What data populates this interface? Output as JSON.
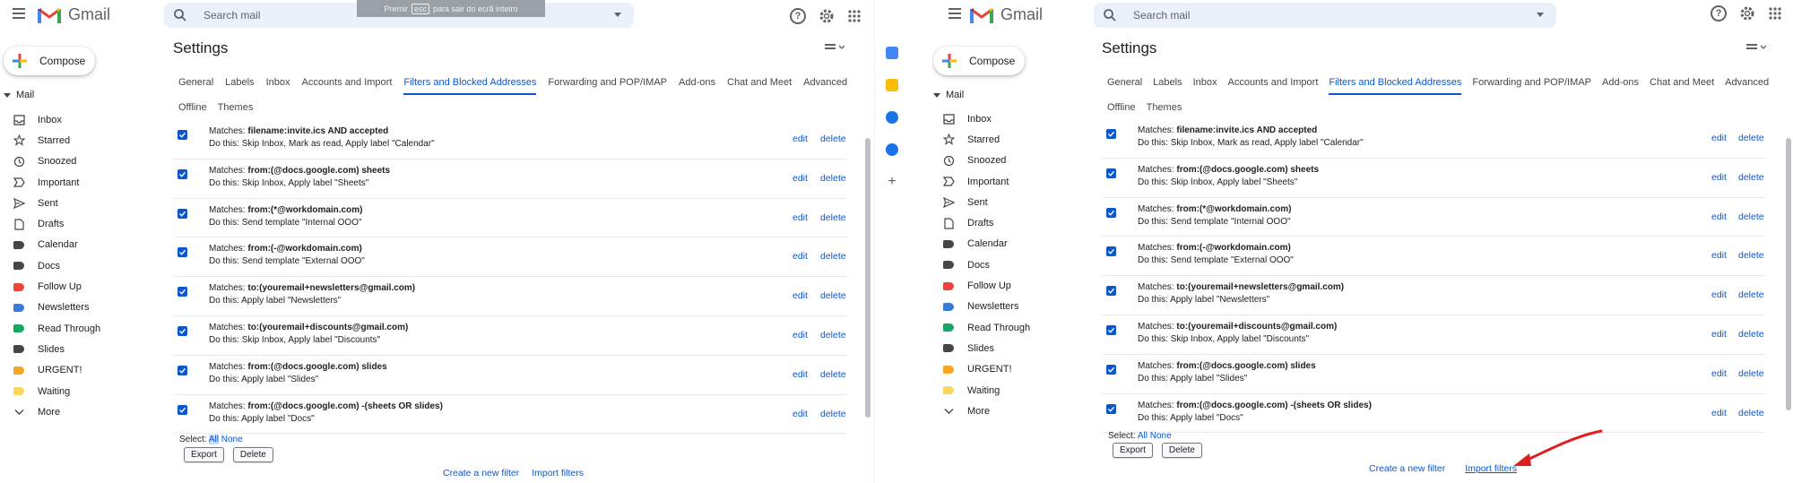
{
  "app": {
    "name": "Gmail",
    "search_placeholder": "Search mail",
    "compose_label": "Compose",
    "mail_section": "Mail",
    "esc_banner": {
      "before": "Premir",
      "key": "esc",
      "after": "para sair do ecrã inteiro"
    }
  },
  "nav": [
    {
      "label": "Inbox",
      "icon": "inbox-icon"
    },
    {
      "label": "Starred",
      "icon": "star-icon"
    },
    {
      "label": "Snoozed",
      "icon": "clock-icon"
    },
    {
      "label": "Important",
      "icon": "important-icon"
    },
    {
      "label": "Sent",
      "icon": "send-icon"
    },
    {
      "label": "Drafts",
      "icon": "draft-icon"
    },
    {
      "label": "Calendar",
      "icon": "label-icon",
      "color": "#444746"
    },
    {
      "label": "Docs",
      "icon": "label-icon",
      "color": "#444746"
    },
    {
      "label": "Follow Up",
      "icon": "label-icon",
      "color": "#e8453c"
    },
    {
      "label": "Newsletters",
      "icon": "label-icon",
      "color": "#3a7bd5"
    },
    {
      "label": "Read Through",
      "icon": "label-icon",
      "color": "#16a765"
    },
    {
      "label": "Slides",
      "icon": "label-icon",
      "color": "#444746"
    },
    {
      "label": "URGENT!",
      "icon": "label-icon",
      "color": "#f6a623"
    },
    {
      "label": "Waiting",
      "icon": "label-icon",
      "color": "#fbd75b"
    },
    {
      "label": "More",
      "icon": "chevron-down-icon"
    }
  ],
  "settings": {
    "title": "Settings",
    "tabs": [
      "General",
      "Labels",
      "Inbox",
      "Accounts and Import",
      "Filters and Blocked Addresses",
      "Forwarding and POP/IMAP",
      "Add-ons",
      "Chat and Meet",
      "Advanced"
    ],
    "active_tab": "Filters and Blocked Addresses",
    "tabs_row2": [
      "Offline",
      "Themes"
    ],
    "matches_label": "Matches:",
    "do_label": "Do this:",
    "edit_label": "edit",
    "delete_label": "delete",
    "filters": [
      {
        "match": "filename:invite.ics AND accepted",
        "action": "Skip Inbox, Mark as read, Apply label \"Calendar\""
      },
      {
        "match": "from:(@docs.google.com) sheets",
        "action": "Skip Inbox, Apply label \"Sheets\""
      },
      {
        "match": "from:(*@workdomain.com)",
        "action": "Send template \"Internal OOO\""
      },
      {
        "match": "from:(-@workdomain.com)",
        "action": "Send template \"External OOO\""
      },
      {
        "match": "to:(youremail+newsletters@gmail.com)",
        "action": "Apply label \"Newsletters\""
      },
      {
        "match": "to:(youremail+discounts@gmail.com)",
        "action": "Skip Inbox, Apply label \"Discounts\""
      },
      {
        "match": "from:(@docs.google.com) slides",
        "action": "Apply label \"Slides\""
      },
      {
        "match": "from:(@docs.google.com) -(sheets OR slides)",
        "action": "Apply label \"Docs\""
      }
    ],
    "select_label": "Select:",
    "select_all": "All",
    "select_none": "None",
    "export_label": "Export",
    "delete_button": "Delete",
    "create_filter": "Create a new filter",
    "import_filters": "Import filters"
  },
  "colors": {
    "accent": "#0b57d0",
    "search_bg": "#eaf1fb",
    "annotation_arrow": "#e02020"
  }
}
